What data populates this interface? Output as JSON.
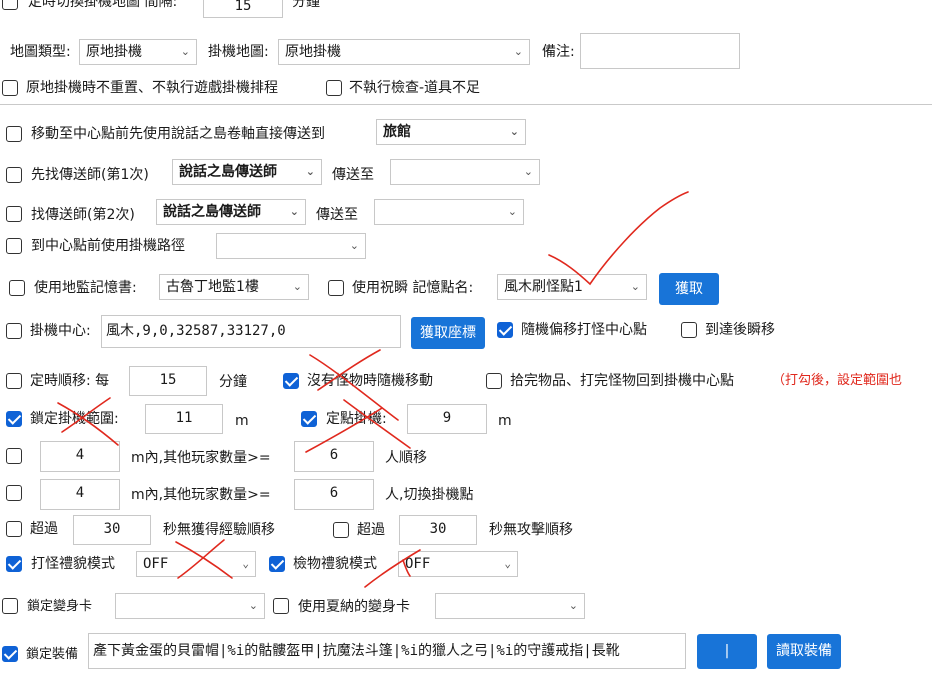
{
  "top": {
    "label": "定時切換掛機地圖 間隔:",
    "value": "15",
    "unit": "分鐘"
  },
  "map_row": {
    "map_type_label": "地圖類型:",
    "map_type_value": "原地掛機",
    "idle_map_label": "掛機地圖:",
    "idle_map_value": "原地掛機",
    "note_label": "備注:",
    "note_value": ""
  },
  "opt_row": {
    "no_reset": "原地掛機時不重置、不執行遊戲掛機排程",
    "no_check": "不執行檢查-道具不足"
  },
  "teleport": {
    "label": "移動至中心點前先使用說話之島卷軸直接傳送到",
    "value": "旅館"
  },
  "find1": {
    "label": "先找傳送師(第1次)",
    "npc": "說話之島傳送師",
    "to_label": "傳送至",
    "to_value": ""
  },
  "find2": {
    "label": "找傳送師(第2次)",
    "npc": "說話之島傳送師",
    "to_label": "傳送至",
    "to_value": ""
  },
  "path": {
    "label": "到中心點前使用掛機路徑",
    "value": ""
  },
  "memory": {
    "dungeon_label": "使用地監記憶書:",
    "dungeon_value": "古魯丁地監1樓",
    "bless_label": "使用祝瞬 記憶點名:",
    "bless_value": "風木刷怪點1",
    "get_button": "獲取"
  },
  "center": {
    "label": "掛機中心:",
    "value": "風木,9,0,32587,33127,0",
    "get_coord_button": "獲取座標",
    "random_offset": "隨機偏移打怪中心點",
    "teleport_on_arrive": "到達後瞬移"
  },
  "timed": {
    "label": "定時順移: 每",
    "value": "15",
    "unit": "分鐘",
    "random_move": "沒有怪物時隨機移動",
    "return_center": "拾完物品、打完怪物回到掛機中心點",
    "note": "（打勾後，設定範圍也"
  },
  "lock": {
    "range_label": "鎖定掛機範圍:",
    "range_value": "11",
    "range_unit": "m",
    "fixed_label": "定點掛機:",
    "fixed_value": "9",
    "fixed_unit": "m"
  },
  "players1": {
    "range": "4",
    "label": "m內,其他玩家數量>=",
    "count": "6",
    "suffix": "人順移"
  },
  "players2": {
    "range": "4",
    "label": "m內,其他玩家數量>=",
    "count": "6",
    "suffix": "人,切換掛機點"
  },
  "timeout": {
    "exp_label": "超過",
    "exp_value": "30",
    "exp_suffix": "秒無獲得經驗順移",
    "atk_label": "超過",
    "atk_value": "30",
    "atk_suffix": "秒無攻擊順移"
  },
  "courtesy": {
    "fight_label": "打怪禮貌模式",
    "fight_value": "OFF",
    "pick_label": "檢物禮貌模式",
    "pick_value": "OFF"
  },
  "transform": {
    "lock_label": "鎖定變身卡",
    "lock_value": "",
    "summer_label": "使用夏納的變身卡",
    "summer_value": ""
  },
  "equip": {
    "label": "鎖定裝備",
    "value": "產下黃金蛋的貝雷帽|%i的骷髏盔甲|抗魔法斗篷|%i的獵人之弓|%i的守護戒指|長靴",
    "sep_button": "|",
    "read_button": "讀取裝備"
  },
  "checked": {
    "random_offset": true,
    "random_move": true,
    "lock_range": true,
    "fixed_point": true,
    "fight_courtesy": true,
    "pick_courtesy": true,
    "lock_equip": true
  },
  "colors": {
    "accent": "#0f62d6",
    "button": "#1874d8",
    "warning": "#e0291e",
    "annotation": "#e0291e"
  }
}
